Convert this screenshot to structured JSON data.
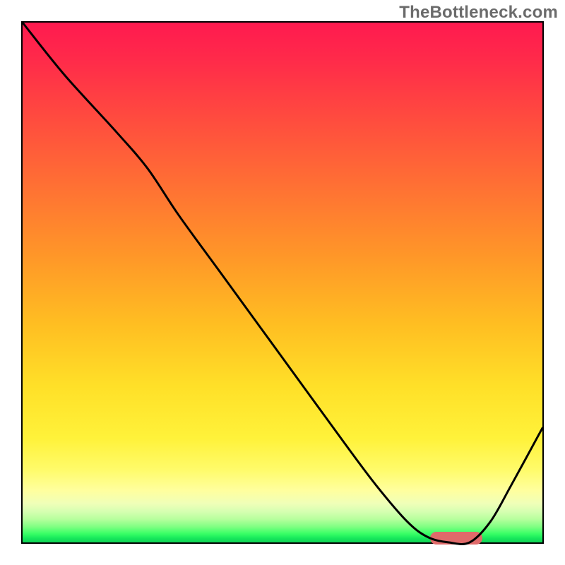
{
  "attribution": "TheBottleneck.com",
  "chart_data": {
    "type": "line",
    "title": "",
    "xlabel": "",
    "ylabel": "",
    "xlim": [
      0,
      100
    ],
    "ylim": [
      0,
      100
    ],
    "grid": false,
    "series": [
      {
        "name": "curve",
        "x": [
          0,
          8,
          18,
          24,
          30,
          38,
          46,
          54,
          62,
          68,
          74,
          78,
          82,
          86,
          90,
          94,
          100
        ],
        "y": [
          100,
          90,
          79,
          72,
          63,
          52,
          41,
          30,
          19,
          11,
          4,
          1,
          0,
          0,
          4,
          11,
          22
        ]
      }
    ],
    "marker": {
      "x_start": 78,
      "x_end": 88,
      "y": 1.3
    }
  },
  "colors": {
    "curve": "#000000",
    "marker": "#e06a6a",
    "frame": "#000000"
  }
}
